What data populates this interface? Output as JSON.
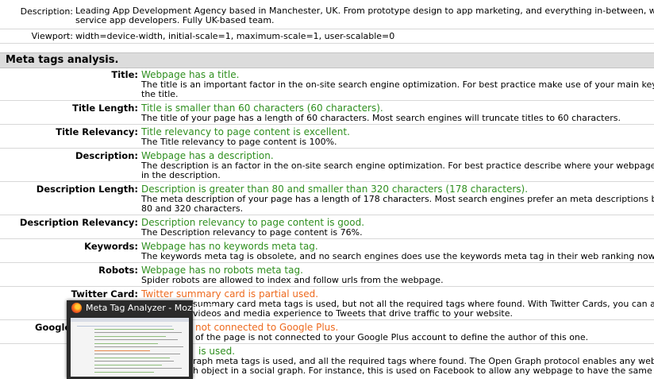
{
  "top_rows": [
    {
      "label": "Description:",
      "lines": [
        "Leading App Development Agency based in Manchester, UK. From prototype design to app marketing, and everything in-between, we're fu",
        "service app developers. Fully UK-based team."
      ]
    },
    {
      "label": "Viewport:",
      "lines": [
        "width=device-width, initial-scale=1, maximum-scale=1, user-scalable=0"
      ]
    }
  ],
  "section_title": "Meta tags analysis.",
  "rows": [
    {
      "label": "Title:",
      "status": "Webpage has a title.",
      "tone": "ok",
      "lines": [
        "The title is an important factor in the on-site search engine optimization. For best practice make use of your main keyword",
        "the title."
      ]
    },
    {
      "label": "Title Length:",
      "status": "Title is smaller than 60 characters (60 characters).",
      "tone": "ok",
      "lines": [
        "The title of your page has a length of 60 characters. Most search engines will truncate titles to 60 characters."
      ]
    },
    {
      "label": "Title Relevancy:",
      "status": "Title relevancy to page content is excellent.",
      "tone": "ok",
      "lines": [
        "The Title relevancy to page content is 100%."
      ]
    },
    {
      "label": "Description:",
      "status": "Webpage has a description.",
      "tone": "ok",
      "lines": [
        "The description is an factor in the on-site search engine optimization. For best practice describe where your webpage is ab",
        "in the description."
      ]
    },
    {
      "label": "Description Length:",
      "status": "Description is greater than 80 and smaller than 320 characters (178 characters).",
      "tone": "ok",
      "lines": [
        "The meta description of your page has a length of 178 characters. Most search engines prefer an meta descriptions betwe",
        "80 and 320 characters."
      ]
    },
    {
      "label": "Description Relevancy:",
      "status": "Description relevancy to page content is good.",
      "tone": "ok",
      "lines": [
        "The Description relevancy to page content is 76%."
      ]
    },
    {
      "label": "Keywords:",
      "status": "Webpage has no keywords meta tag.",
      "tone": "ok",
      "lines": [
        "The keywords meta tag is obsolete, and no search engines does use the keywords meta tag in their web ranking nowaday"
      ]
    },
    {
      "label": "Robots:",
      "status": "Webpage has no robots meta tag.",
      "tone": "ok",
      "lines": [
        "Spider robots are allowed to index and follow urls from the webpage."
      ]
    },
    {
      "label": "Twitter Card:",
      "status": "Twitter summary card is partial used.",
      "tone": "warn",
      "lines": [
        "summary card meta tags is used, but not all the required tags where found. With Twitter Cards, you can attac",
        "videos and media experience to Tweets that drive traffic to your website."
      ]
    },
    {
      "label": "Google",
      "status": "not connected to Google Plus.",
      "tone": "warn",
      "lines": [
        "of the page is not connected to your Google Plus account to define the author of this one."
      ]
    },
    {
      "label": "",
      "status": "is used.",
      "tone": "ok",
      "lines": [
        "raph meta tags is used, and all the required tags where found. The Open Graph protocol enables any webpage",
        "h object in a social graph. For instance, this is used on Facebook to allow any webpage to have the same"
      ]
    }
  ],
  "taskbar_preview": {
    "title": "Meta Tag Analyzer - Mozilla Fir...",
    "icon": "firefox-icon"
  },
  "colors": {
    "ok": "#2f8f1f",
    "warn": "#ee6a1e",
    "section_bg": "#dcdcdc"
  }
}
